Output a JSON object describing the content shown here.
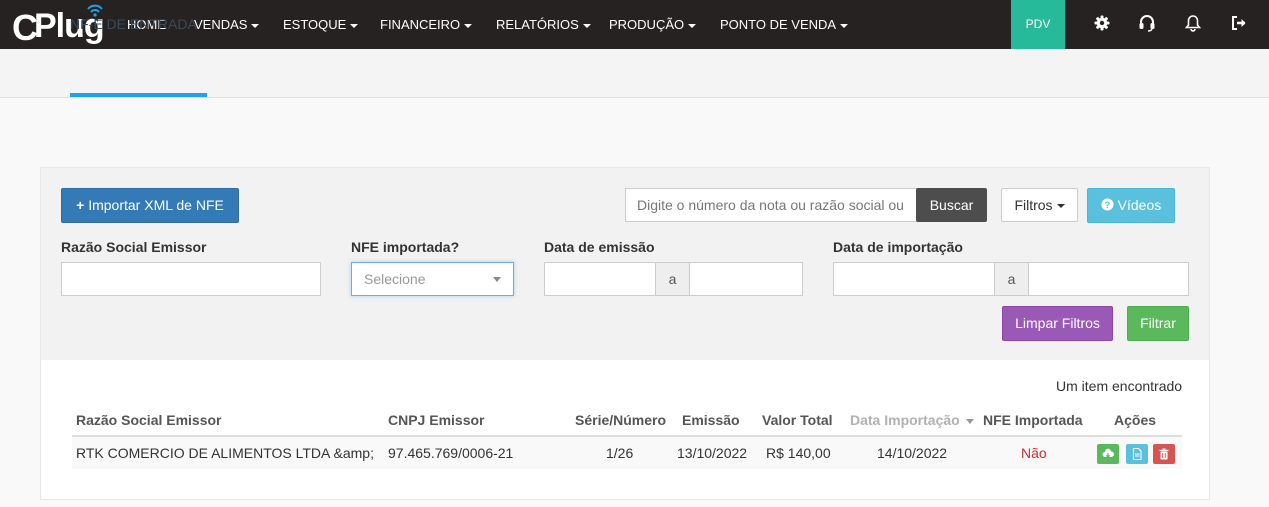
{
  "brand": {
    "name": "CPlug",
    "logo_letter": "C",
    "logo_rest": "Plug"
  },
  "nav": {
    "items": [
      {
        "label": "HOME",
        "dropdown": false
      },
      {
        "label": "VENDAS",
        "dropdown": true
      },
      {
        "label": "ESTOQUE",
        "dropdown": true
      },
      {
        "label": "FINANCEIRO",
        "dropdown": true
      },
      {
        "label": "RELATÓRIOS",
        "dropdown": true
      },
      {
        "label": "PRODUÇÃO",
        "dropdown": true
      },
      {
        "label": "PONTO DE VENDA",
        "dropdown": true
      }
    ],
    "pdv_label": "PDV",
    "icons": [
      "gear-icon",
      "headset-icon",
      "bell-icon",
      "logout-icon"
    ]
  },
  "page": {
    "tab_label": "NF-E DE ENTRADA"
  },
  "toolbar": {
    "import_label": "Importar XML de NFE",
    "search_placeholder": "Digite o número da nota ou razão social ou",
    "search_button": "Buscar",
    "filters_button": "Filtros",
    "videos_button": "Vídeos"
  },
  "filters": {
    "razao_label": "Razão Social Emissor",
    "importada_label": "NFE importada?",
    "importada_placeholder": "Selecione",
    "emissao_label": "Data de emissão",
    "importacao_label": "Data de importação",
    "range_sep": "a",
    "clear_button": "Limpar Filtros",
    "filter_button": "Filtrar"
  },
  "results": {
    "count_text": "Um item encontrado",
    "columns": {
      "razao": "Razão Social Emissor",
      "cnpj": "CNPJ Emissor",
      "serie": "Série/Número",
      "emissao": "Emissão",
      "valor": "Valor Total",
      "data_importacao": "Data Importação",
      "importada": "NFE Importada",
      "acoes": "Ações"
    },
    "rows": [
      {
        "razao": "RTK COMERCIO DE ALIMENTOS LTDA &amp;",
        "cnpj": "97.465.769/0006-21",
        "serie": "1/26",
        "emissao": "13/10/2022",
        "valor": "R$ 140,00",
        "data_importacao": "14/10/2022",
        "importada": "Não"
      }
    ]
  },
  "colors": {
    "navbar": "#262221",
    "pdv": "#26b99a",
    "primary": "#337ab7",
    "info": "#5bc0de",
    "purple": "#9b59b6",
    "success": "#5cb85c",
    "danger": "#d9534f",
    "tab_accent": "#1da1f2"
  }
}
